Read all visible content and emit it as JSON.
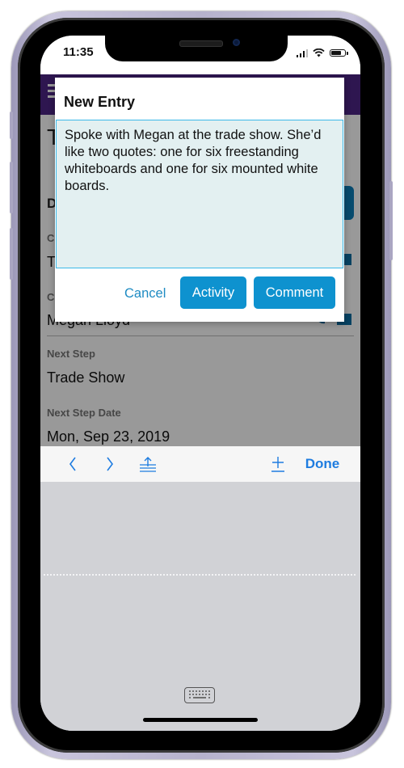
{
  "status_bar": {
    "time": "11:35",
    "icons": [
      "cellular-signal-icon",
      "wifi-icon",
      "battery-icon"
    ]
  },
  "background_page": {
    "title_partial": "T",
    "section_partial": "D",
    "fields": [
      {
        "label_partial": "C",
        "value_partial": "T"
      },
      {
        "label_partial": "C",
        "value": "Megan Lloyd"
      },
      {
        "label": "Next Step",
        "value": "Trade Show"
      },
      {
        "label": "Next Step Date",
        "value": "Mon, Sep 23, 2019"
      }
    ]
  },
  "dialog": {
    "title": "New Entry",
    "text_value": "Spoke with Megan at the trade show. She’d like two quotes: one for six freestanding whiteboards and one for six mounted white boards.",
    "cancel_label": "Cancel",
    "activity_label": "Activity",
    "comment_label": "Comment"
  },
  "keyboard_toolbar": {
    "prev_icon": "chevron-left-icon",
    "next_icon": "chevron-right-icon",
    "upload_icon": "upload-icon",
    "add_icon": "plus-icon",
    "done_label": "Done"
  },
  "colors": {
    "header": "#4e2585",
    "accent": "#0e92cf",
    "text_border": "#3cb9e8",
    "text_bg": "#e3f0f1",
    "toolbar_tint": "#1e7ce0"
  }
}
